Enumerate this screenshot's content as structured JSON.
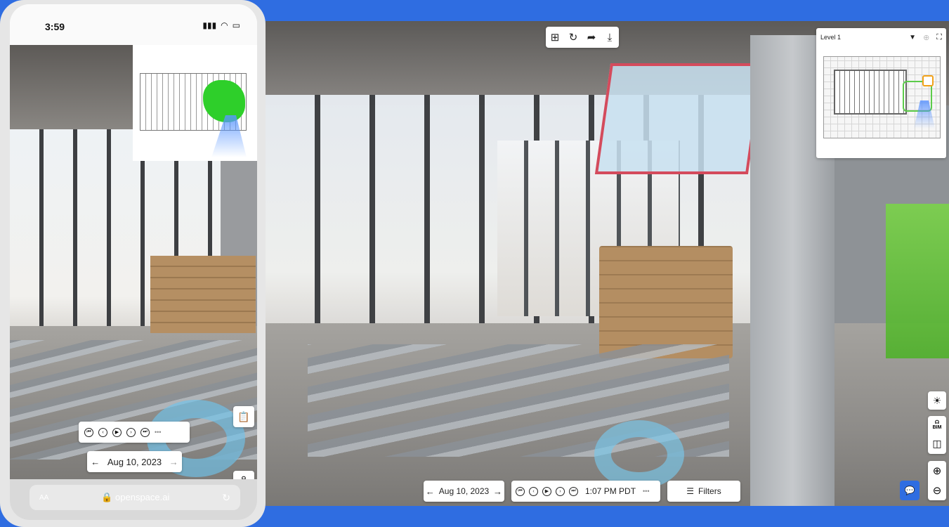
{
  "phone": {
    "status_bar": {
      "time": "3:59",
      "signal_icon": "signal-icon",
      "wifi_icon": "wifi-icon",
      "battery_icon": "battery-icon"
    },
    "date_nav": {
      "prev_label": "←",
      "date": "Aug 10, 2023",
      "next_label": "→"
    },
    "playback": {
      "controls": [
        "skip-start-icon",
        "prev-icon",
        "play-icon",
        "next-icon",
        "skip-end-icon"
      ],
      "more_label": "•••"
    },
    "browser": {
      "text_size_label": "AA",
      "url": "openspace.ai",
      "reload_icon": "reload-icon"
    }
  },
  "viewer": {
    "toolbar": {
      "icons": [
        "add-note-icon",
        "capture-icon",
        "share-icon",
        "download-icon"
      ]
    },
    "minimap": {
      "level": "Level 1",
      "caret": "▼"
    },
    "date_nav": {
      "prev_label": "←",
      "date": "Aug 10, 2023",
      "next_label": "→"
    },
    "playback": {
      "controls": [
        "skip-start-icon",
        "prev-icon",
        "play-icon",
        "next-icon",
        "skip-end-icon"
      ],
      "time": "1:07 PM PDT",
      "more_label": "•••"
    },
    "filters": {
      "label": "Filters"
    },
    "right_rail": {
      "bim_label": "BIM"
    }
  },
  "colors": {
    "background": "#2f6de1",
    "accent": "#2f6de1",
    "path_green": "#5ccc4a",
    "nav_ring": "#78c8eb"
  }
}
